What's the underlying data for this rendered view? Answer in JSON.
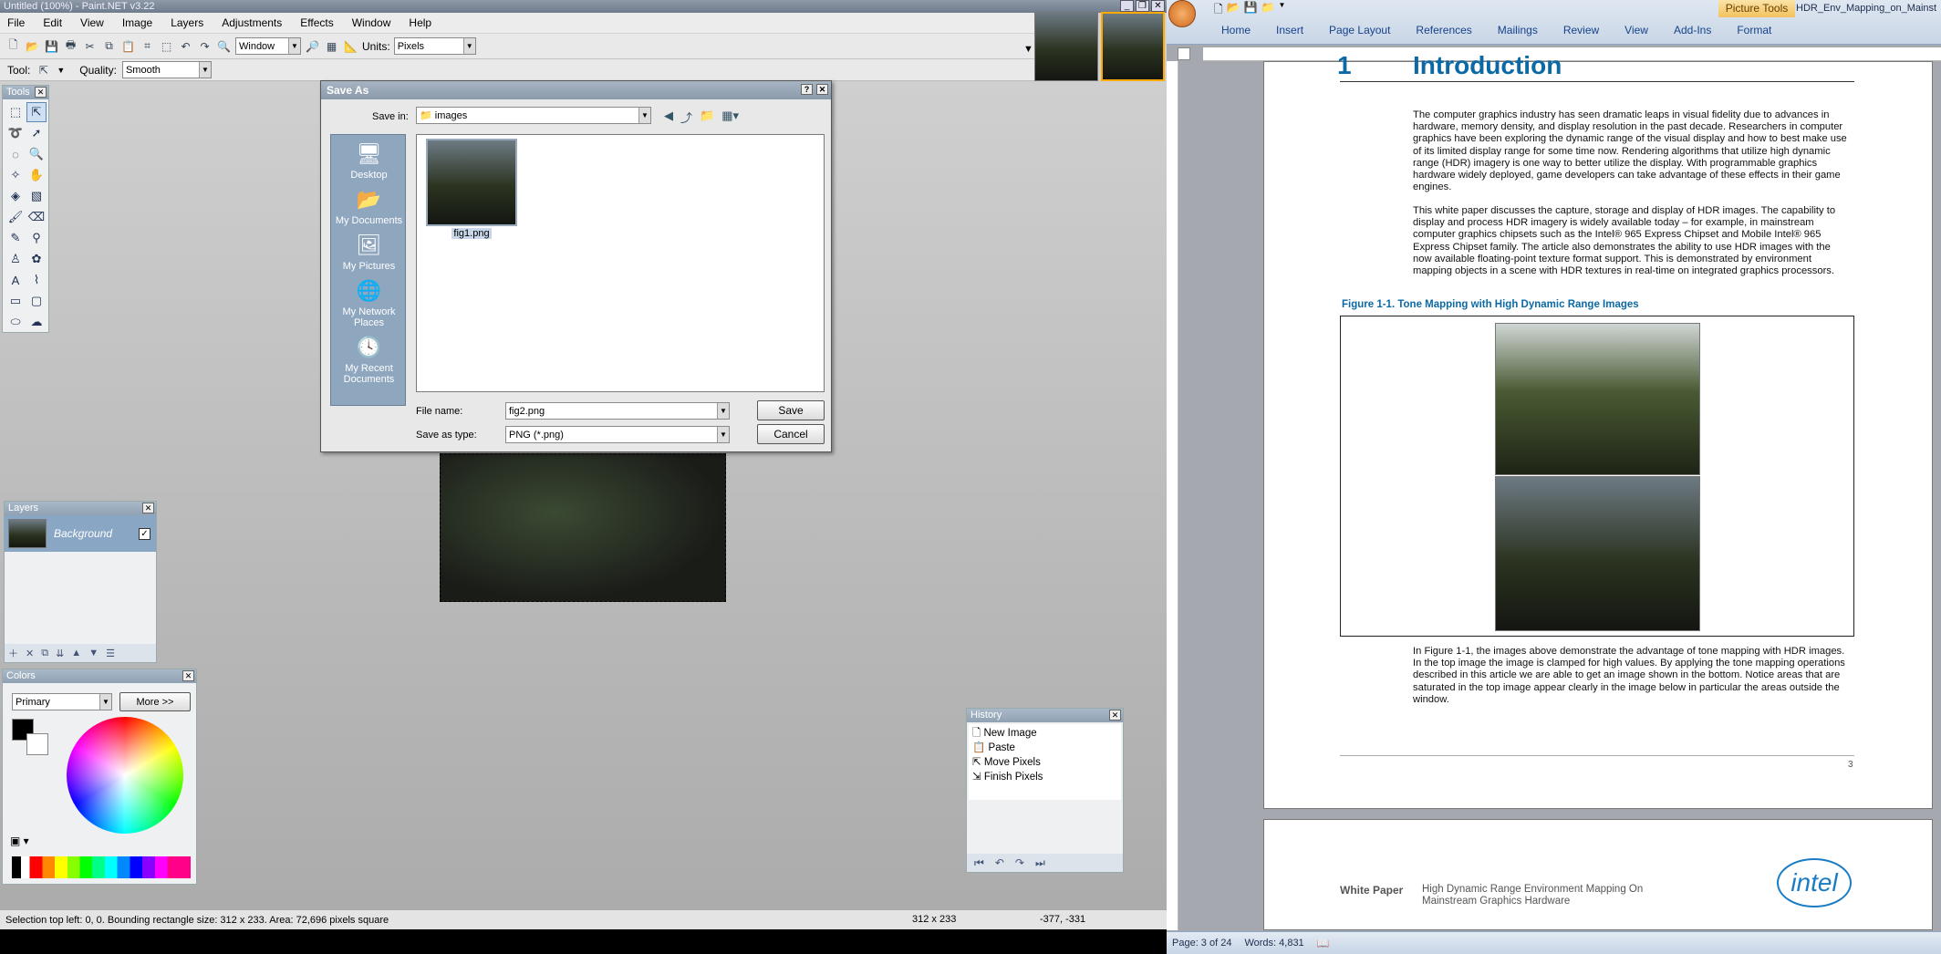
{
  "pdn": {
    "title": "Untitled (100%) - Paint.NET v3.22",
    "menu": [
      "File",
      "Edit",
      "View",
      "Image",
      "Layers",
      "Adjustments",
      "Effects",
      "Window",
      "Help"
    ],
    "zoom_mode": "Window",
    "units_label": "Units:",
    "units_value": "Pixels",
    "tool_label": "Tool:",
    "quality_label": "Quality:",
    "quality_value": "Smooth",
    "tools_title": "Tools",
    "layers_title": "Layers",
    "layer_name": "Background",
    "colors_title": "Colors",
    "colors_mode": "Primary",
    "more_button": "More >>",
    "history_title": "History",
    "history_items": [
      "New Image",
      "Paste",
      "Move Pixels",
      "Finish Pixels"
    ],
    "status_text": "Selection top left: 0, 0. Bounding rectangle size: 312 x 233. Area: 72,696 pixels square",
    "status_size": "312 x 233",
    "status_coords": "-377, -331"
  },
  "dialog": {
    "title": "Save As",
    "save_in_label": "Save in:",
    "save_in_value": "images",
    "places": [
      "Desktop",
      "My Documents",
      "My Pictures",
      "My Network Places",
      "My Recent Documents"
    ],
    "file": "fig1.png",
    "file_name_label": "File name:",
    "file_name_value": "fig2.png",
    "type_label": "Save as type:",
    "type_value": "PNG (*.png)",
    "save_button": "Save",
    "cancel_button": "Cancel"
  },
  "word": {
    "title": "HDR_Env_Mapping_on_Mainst",
    "context_tab": "Picture Tools",
    "tabs": [
      "Home",
      "Insert",
      "Page Layout",
      "References",
      "Mailings",
      "Review",
      "View",
      "Add-Ins",
      "Format"
    ],
    "heading_num": "1",
    "heading": "Introduction",
    "para1": "The computer graphics industry has seen dramatic leaps in visual fidelity due to advances in hardware, memory density, and display resolution in the past decade. Researchers in computer graphics have been exploring the dynamic range of the visual display and how to best make use of its limited display range for some time now. Rendering algorithms that utilize high dynamic range (HDR) imagery is one way to better utilize the display. With programmable graphics hardware widely deployed, game developers can take advantage of these effects in their game engines.",
    "para2": "This white paper discusses the capture, storage and display of HDR images. The capability to display and process HDR imagery is widely available today – for example, in mainstream computer graphics chipsets such as the Intel® 965 Express Chipset and Mobile Intel® 965 Express Chipset family. The article also demonstrates the ability to use HDR images with the now available floating-point texture format support. This is demonstrated by environment mapping objects in a scene with HDR textures in real-time on integrated graphics processors.",
    "figure_caption": "Figure 1-1. Tone Mapping with High Dynamic Range Images",
    "para3": "In Figure 1-1, the images above demonstrate the advantage of tone mapping with HDR images. In the top image the image is clamped for high values. By applying the tone mapping operations described in this article we are able to get an image shown in the bottom. Notice areas that are saturated in the top image appear clearly in the image below in particular the areas outside the window.",
    "page_num": "3",
    "header_label": "White Paper",
    "header_title": "High Dynamic Range Environment Mapping On Mainstream Graphics Hardware",
    "logo": "intel",
    "status_page": "Page: 3 of 24",
    "status_words": "Words: 4,831"
  }
}
